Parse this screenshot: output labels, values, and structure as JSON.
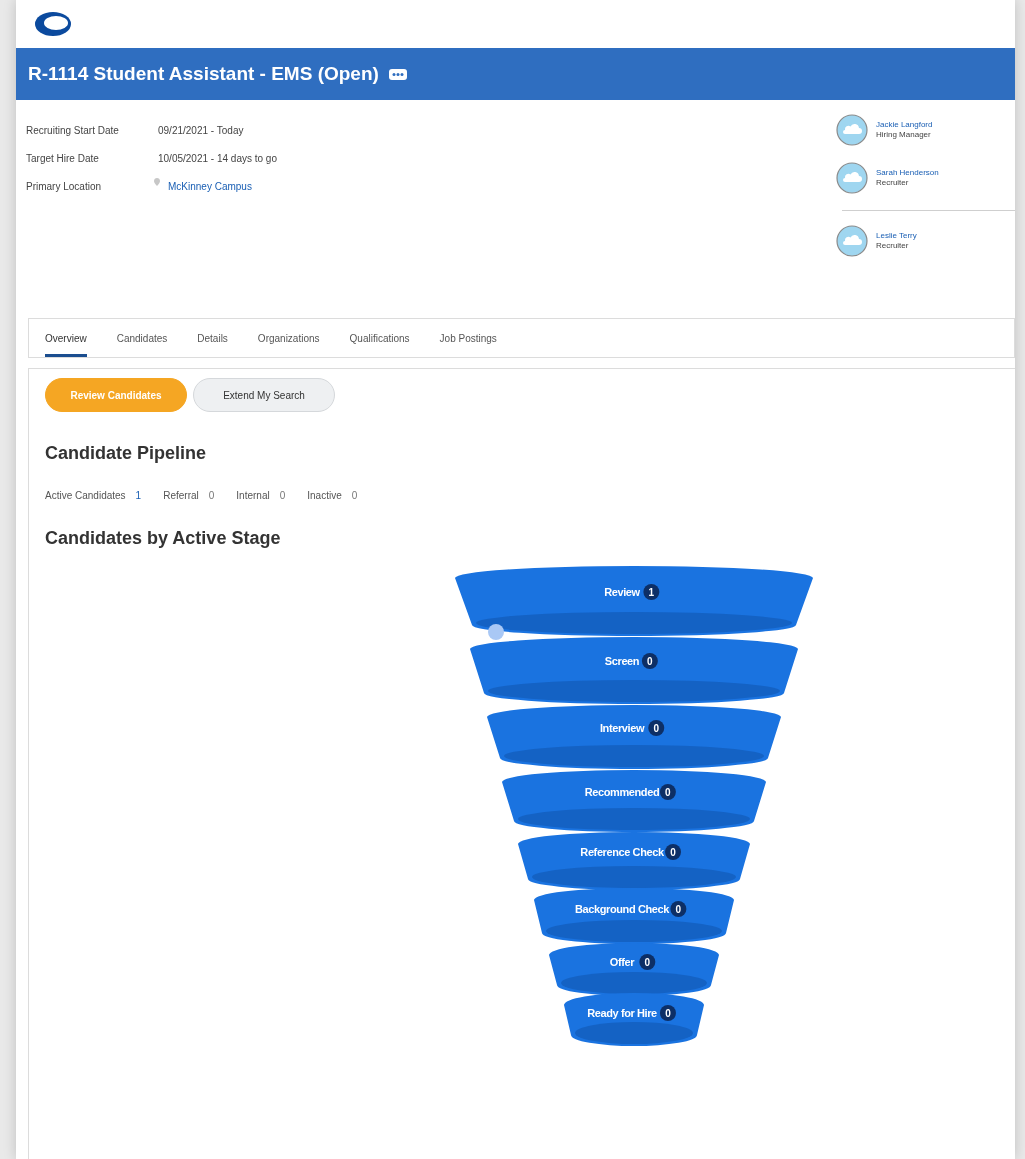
{
  "header": {
    "title": "R-1114 Student Assistant - EMS (Open)"
  },
  "details": [
    {
      "label": "Recruiting Start Date",
      "value": "09/21/2021 - Today",
      "kind": "text"
    },
    {
      "label": "Target Hire Date",
      "value": "10/05/2021 - 14 days to go",
      "kind": "text"
    },
    {
      "label": "Primary Location",
      "value": "McKinney Campus",
      "kind": "location"
    }
  ],
  "people": [
    {
      "name": "Jackie Langford",
      "role": "Hiring Manager"
    },
    {
      "name": "Sarah Henderson",
      "role": "Recruiter"
    },
    {
      "name": "Leslie Terry",
      "role": "Recruiter"
    }
  ],
  "tabs": [
    {
      "label": "Overview",
      "selected": true
    },
    {
      "label": "Candidates",
      "selected": false
    },
    {
      "label": "Details",
      "selected": false
    },
    {
      "label": "Organizations",
      "selected": false
    },
    {
      "label": "Qualifications",
      "selected": false
    },
    {
      "label": "Job Postings",
      "selected": false
    }
  ],
  "buttons": [
    {
      "label": "Review Candidates",
      "kind": "primary"
    },
    {
      "label": "Extend My Search",
      "kind": "secondary"
    }
  ],
  "pipeline": {
    "title": "Candidate Pipeline",
    "counts": [
      {
        "label": "Active Candidates",
        "value": "1",
        "kind": "link"
      },
      {
        "label": "Referral",
        "value": "0",
        "kind": "plain"
      },
      {
        "label": "Internal",
        "value": "0",
        "kind": "plain"
      },
      {
        "label": "Inactive",
        "value": "0",
        "kind": "plain"
      }
    ]
  },
  "stages_title": "Candidates by Active Stage",
  "stages": [
    {
      "label": "Review",
      "count": "1"
    },
    {
      "label": "Screen",
      "count": "0"
    },
    {
      "label": "Interview",
      "count": "0"
    },
    {
      "label": "Recommended",
      "count": "0"
    },
    {
      "label": "Reference Check",
      "count": "0"
    },
    {
      "label": "Background Check",
      "count": "0"
    },
    {
      "label": "Offer",
      "count": "0"
    },
    {
      "label": "Ready for Hire",
      "count": "0"
    }
  ]
}
